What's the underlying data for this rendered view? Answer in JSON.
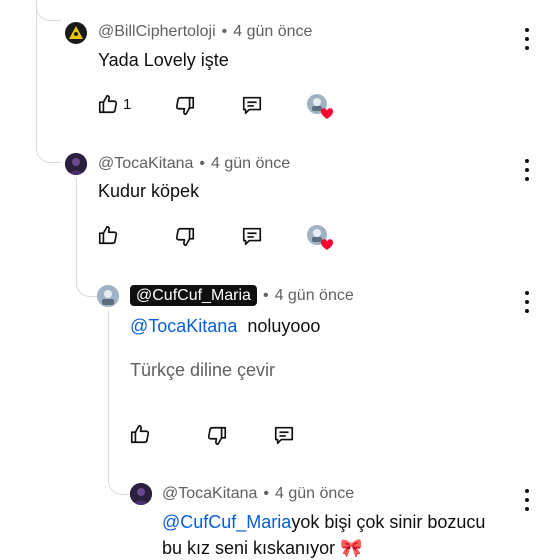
{
  "comments": [
    {
      "handle": "@BillCiphertoloji",
      "time": "4 gün önce",
      "text": "Yada Lovely işte",
      "likes": "1"
    },
    {
      "handle": "@TocaKitana",
      "time": "4 gün önce",
      "text": "Kudur köpek",
      "likes": ""
    },
    {
      "handle": "@CufCuf_Maria",
      "time": "4 gün önce",
      "mention": "@TocaKitana",
      "text": "noluyooo",
      "translate_label": "Türkçe diline çevir",
      "likes": ""
    },
    {
      "handle": "@TocaKitana",
      "time": "4 gün önce",
      "mention": "@CufCuf_Maria",
      "text_line1": "yok bişi çok sinir bozucu",
      "text_line2": "bu kız seni kıskanıyor 🎀"
    }
  ],
  "colors": {
    "mention": "#065fd4",
    "meta": "#606060",
    "heart": "#ff0033",
    "thread_line": "#d9d9d9"
  },
  "icons": [
    "like-icon",
    "dislike-icon",
    "reply-icon",
    "creator-heart-icon",
    "more-options-icon"
  ]
}
